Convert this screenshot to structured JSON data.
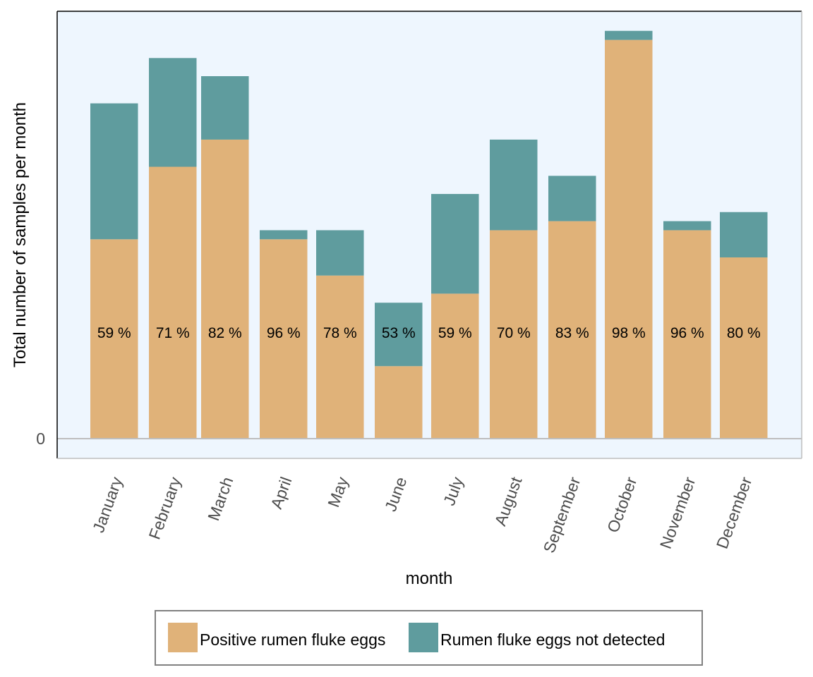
{
  "chart_data": {
    "type": "bar",
    "stacked": true,
    "title": "",
    "xlabel": "month",
    "ylabel": "Total number of samples per month",
    "y_ticks": [
      "0"
    ],
    "ylim": [
      0,
      47
    ],
    "categories": [
      "January",
      "February",
      "March",
      "April",
      "May",
      "June",
      "July",
      "August",
      "September",
      "October",
      "November",
      "December"
    ],
    "series": [
      {
        "name": "Positive rumen fluke eggs",
        "color": "#E0B279",
        "values": [
          22,
          30,
          33,
          22,
          18,
          8,
          16,
          23,
          24,
          44,
          23,
          20
        ]
      },
      {
        "name": "Rumen fluke eggs not detected",
        "color": "#5F9C9E",
        "values": [
          15,
          12,
          7,
          1,
          5,
          7,
          11,
          10,
          5,
          1,
          1,
          5
        ]
      }
    ],
    "data_labels": [
      "59 %",
      "71 %",
      "82 %",
      "96 %",
      "78 %",
      "53 %",
      "59 %",
      "70 %",
      "83 %",
      "98 %",
      "96 %",
      "80 %"
    ],
    "legend": {
      "position": "bottom",
      "entries": [
        "Positive rumen fluke eggs",
        "Rumen fluke eggs not detected"
      ]
    },
    "grid": false,
    "panel_background": "#EEF6FE"
  }
}
